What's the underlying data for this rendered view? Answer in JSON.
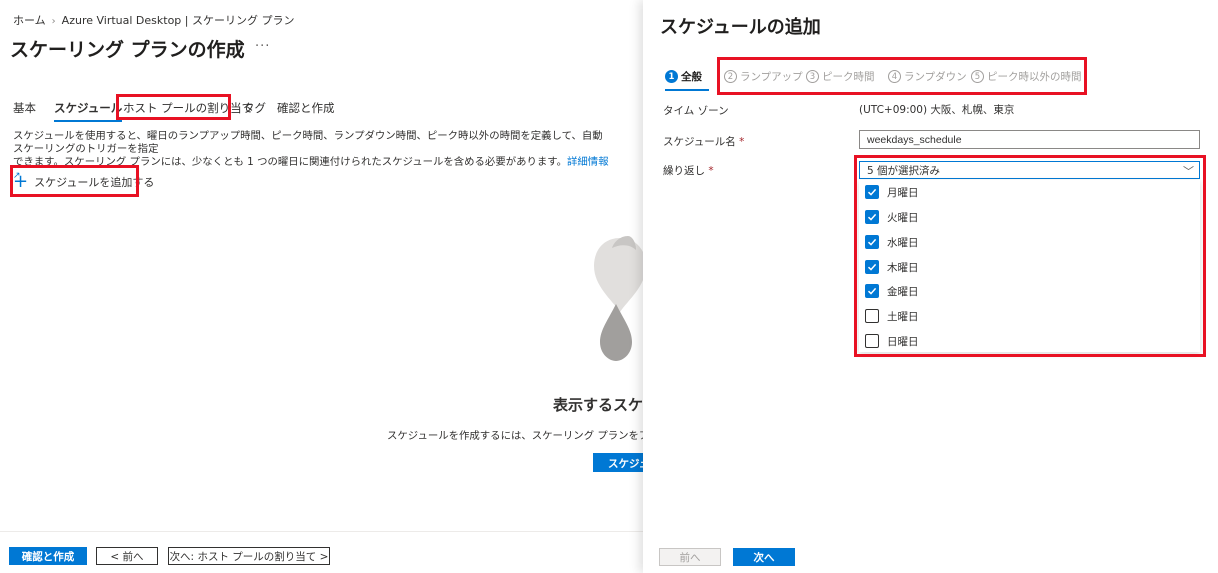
{
  "breadcrumb": {
    "home": "ホーム",
    "parent": "Azure Virtual Desktop | スケーリング プラン"
  },
  "page": {
    "title": "スケーリング プランの作成",
    "more": "···"
  },
  "tabs": [
    {
      "label": "基本"
    },
    {
      "label": "スケジュール",
      "active": true
    },
    {
      "label": "ホスト プールの割り当て"
    },
    {
      "label": "タグ"
    },
    {
      "label": "確認と作成"
    }
  ],
  "description": {
    "line1": "スケジュールを使用すると、曜日のランプアップ時間、ピーク時間、ランプダウン時間、ピーク時以外の時間を定義して、自動スケーリングのトリガーを指定",
    "line2": "できます。スケーリング プランには、少なくとも 1 つの曜日に関連付けられたスケジュールを含める必要があります。",
    "link": "詳細情報"
  },
  "add_schedule": {
    "label": "スケジュールを追加する"
  },
  "empty_state": {
    "title": "表示するスケジ",
    "description": "スケジュールを作成するには、スケーリング プランをアクティブにする日",
    "button": "スケジュー"
  },
  "footer": {
    "review_create": "確認と作成",
    "prev": "< 前へ",
    "next": "次へ: ホスト プールの割り当て >"
  },
  "panel": {
    "title": "スケジュールの追加",
    "steps": [
      {
        "num": "1",
        "label": "全般",
        "active": true
      },
      {
        "num": "2",
        "label": "ランプアップ"
      },
      {
        "num": "3",
        "label": "ピーク時間"
      },
      {
        "num": "4",
        "label": "ランプダウン"
      },
      {
        "num": "5",
        "label": "ピーク時以外の時間"
      }
    ],
    "timezone": {
      "label": "タイム ゾーン",
      "value": "(UTC+09:00) 大阪、札幌、東京"
    },
    "schedule_name": {
      "label": "スケジュール名",
      "value": "weekdays_schedule"
    },
    "repeat": {
      "label": "繰り返し",
      "selected": "5 個が選択済み"
    },
    "days": [
      {
        "label": "月曜日",
        "checked": true
      },
      {
        "label": "火曜日",
        "checked": true
      },
      {
        "label": "水曜日",
        "checked": true
      },
      {
        "label": "木曜日",
        "checked": true
      },
      {
        "label": "金曜日",
        "checked": true
      },
      {
        "label": "土曜日",
        "checked": false
      },
      {
        "label": "日曜日",
        "checked": false
      }
    ],
    "prev": "前へ",
    "next": "次へ"
  },
  "required_mark": "*",
  "colors": {
    "accent": "#0078d4",
    "highlight": "#e81123"
  }
}
